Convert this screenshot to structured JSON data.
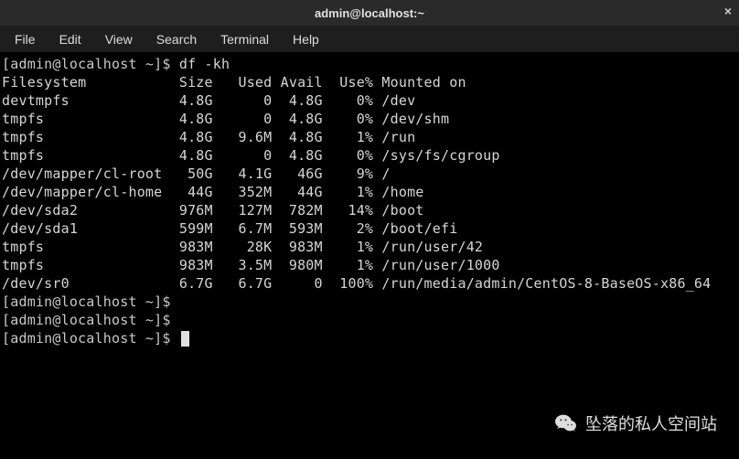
{
  "window": {
    "title": "admin@localhost:~",
    "close_glyph": "×"
  },
  "menu": {
    "items": [
      "File",
      "Edit",
      "View",
      "Search",
      "Terminal",
      "Help"
    ]
  },
  "terminal": {
    "prompt": "[admin@localhost ~]$ ",
    "command": "df -kh",
    "header": {
      "filesystem": "Filesystem",
      "size": "Size",
      "used": "Used",
      "avail": "Avail",
      "usep": "Use%",
      "mounted": "Mounted on"
    },
    "rows": [
      {
        "fs": "devtmpfs",
        "size": "4.8G",
        "used": "0",
        "avail": "4.8G",
        "usep": "0%",
        "mnt": "/dev"
      },
      {
        "fs": "tmpfs",
        "size": "4.8G",
        "used": "0",
        "avail": "4.8G",
        "usep": "0%",
        "mnt": "/dev/shm"
      },
      {
        "fs": "tmpfs",
        "size": "4.8G",
        "used": "9.6M",
        "avail": "4.8G",
        "usep": "1%",
        "mnt": "/run"
      },
      {
        "fs": "tmpfs",
        "size": "4.8G",
        "used": "0",
        "avail": "4.8G",
        "usep": "0%",
        "mnt": "/sys/fs/cgroup"
      },
      {
        "fs": "/dev/mapper/cl-root",
        "size": "50G",
        "used": "4.1G",
        "avail": "46G",
        "usep": "9%",
        "mnt": "/"
      },
      {
        "fs": "/dev/mapper/cl-home",
        "size": "44G",
        "used": "352M",
        "avail": "44G",
        "usep": "1%",
        "mnt": "/home"
      },
      {
        "fs": "/dev/sda2",
        "size": "976M",
        "used": "127M",
        "avail": "782M",
        "usep": "14%",
        "mnt": "/boot"
      },
      {
        "fs": "/dev/sda1",
        "size": "599M",
        "used": "6.7M",
        "avail": "593M",
        "usep": "2%",
        "mnt": "/boot/efi"
      },
      {
        "fs": "tmpfs",
        "size": "983M",
        "used": "28K",
        "avail": "983M",
        "usep": "1%",
        "mnt": "/run/user/42"
      },
      {
        "fs": "tmpfs",
        "size": "983M",
        "used": "3.5M",
        "avail": "980M",
        "usep": "1%",
        "mnt": "/run/user/1000"
      },
      {
        "fs": "/dev/sr0",
        "size": "6.7G",
        "used": "6.7G",
        "avail": "0",
        "usep": "100%",
        "mnt": "/run/media/admin/CentOS-8-BaseOS-x86_64"
      }
    ],
    "trailing_prompts": 3
  },
  "watermark": {
    "text": "坠落的私人空间站"
  },
  "colors": {
    "bg": "#000000",
    "fg": "#d6d6d6",
    "titlebar": "#2a2a2a",
    "menubar": "#1e1e1e"
  }
}
